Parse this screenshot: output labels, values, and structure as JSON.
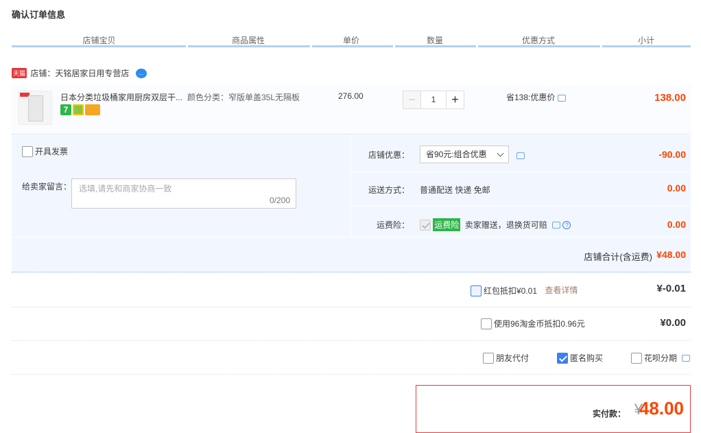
{
  "page_title": "确认订单信息",
  "columns": [
    "店铺宝贝",
    "商品属性",
    "单价",
    "数量",
    "优惠方式",
    "小计"
  ],
  "shop": {
    "badge": "天猫",
    "label": "店铺：天铭居家日用专营店"
  },
  "item": {
    "title": "日本分类垃圾桶家用厨房双层干...",
    "attr": "颜色分类：窄版单盖35L无隔板",
    "price": "276.00",
    "quantity": "1",
    "minus": "−",
    "plus": "+",
    "promo": "省138:优惠价",
    "subtotal": "138.00",
    "badge_7": "7"
  },
  "invoice_label": "开具发票",
  "memo": {
    "label": "给卖家留言：",
    "placeholder": "选填,请先和商家协商一致",
    "count": "0/200"
  },
  "shop_discount": {
    "label": "店铺优惠：",
    "selected": "省90元:组合优惠",
    "amount": "-90.00"
  },
  "shipping": {
    "label": "运送方式：",
    "value": "普通配送 快递 免邮",
    "amount": "0.00"
  },
  "insurance": {
    "label": "运费险：",
    "tag": "运费险",
    "text": "卖家赠送，退换货可赔",
    "amount": "0.00"
  },
  "shop_total": {
    "label": "店铺合计(含运费)",
    "amount": "¥48.00"
  },
  "red_packet": {
    "label": "红包抵扣¥0.01",
    "link": "查看详情",
    "amount": "¥-0.01"
  },
  "coins": {
    "label": "使用96淘金币抵扣0.96元",
    "amount": "¥0.00"
  },
  "options": {
    "friend_pay": "朋友代付",
    "anonymous": "匿名购买",
    "huabei": "花呗分期"
  },
  "payment": {
    "label": "实付款：",
    "currency": "¥",
    "amount": "48.00"
  },
  "colors": {
    "accent": "#ff4400",
    "header_line": "#b2d1f5",
    "panel_bg": "#f2f7ff"
  }
}
